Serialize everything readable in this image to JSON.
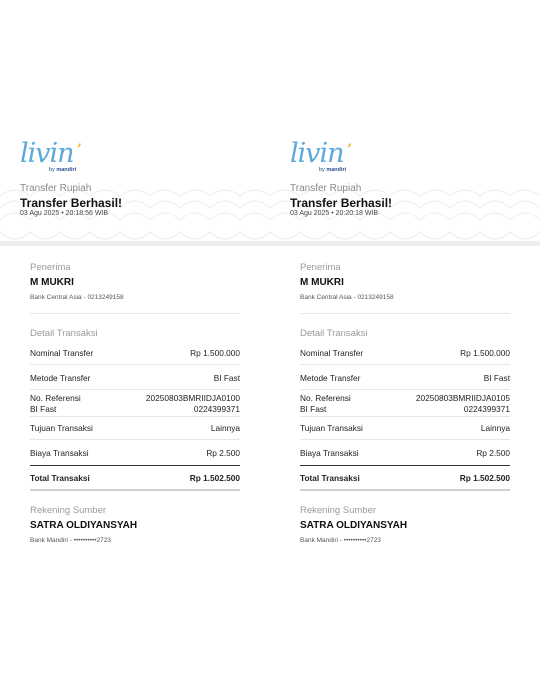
{
  "receipts": [
    {
      "logo": {
        "word": "livin",
        "apostrophe": "’",
        "by": "by",
        "brand": "mandiri"
      },
      "header": {
        "subtitle": "Transfer Rupiah",
        "title": "Transfer Berhasil!",
        "datetime": "03 Agu 2025 • 20:18:56 WIB"
      },
      "recipient": {
        "label": "Penerima",
        "name": "M MUKRI",
        "bank_info": "Bank Central Asia - 0213249158"
      },
      "detail": {
        "label": "Detail Transaksi",
        "nominal_label": "Nominal Transfer",
        "nominal_value": "Rp 1.500.000",
        "method_label": "Metode Transfer",
        "method_value": "BI Fast",
        "ref_label": "No. Referensi",
        "ref_value": "20250803BMRIIDJA0100",
        "bifast_label": "BI Fast",
        "bifast_value": "0224399371",
        "purpose_label": "Tujuan Transaksi",
        "purpose_value": "Lainnya",
        "fee_label": "Biaya Transaksi",
        "fee_value": "Rp 2.500",
        "total_label": "Total Transaksi",
        "total_value": "Rp 1.502.500"
      },
      "source": {
        "label": "Rekening Sumber",
        "name": "SATRA OLDIYANSYAH",
        "account": "Bank Mandiri - ••••••••••2723"
      }
    },
    {
      "logo": {
        "word": "livin",
        "apostrophe": "’",
        "by": "by",
        "brand": "mandiri"
      },
      "header": {
        "subtitle": "Transfer Rupiah",
        "title": "Transfer Berhasil!",
        "datetime": "03 Agu 2025 • 20:20:18 WIB"
      },
      "recipient": {
        "label": "Penerima",
        "name": "M MUKRI",
        "bank_info": "Bank Central Asia - 0213249158"
      },
      "detail": {
        "label": "Detail Transaksi",
        "nominal_label": "Nominal Transfer",
        "nominal_value": "Rp 1.500.000",
        "method_label": "Metode Transfer",
        "method_value": "BI Fast",
        "ref_label": "No. Referensi",
        "ref_value": "20250803BMRIIDJA0105",
        "bifast_label": "BI Fast",
        "bifast_value": "0224399371",
        "purpose_label": "Tujuan Transaksi",
        "purpose_value": "Lainnya",
        "fee_label": "Biaya Transaksi",
        "fee_value": "Rp 2.500",
        "total_label": "Total Transaksi",
        "total_value": "Rp 1.502.500"
      },
      "source": {
        "label": "Rekening Sumber",
        "name": "SATRA OLDIYANSYAH",
        "account": "Bank Mandiri - ••••••••••2723"
      }
    }
  ],
  "colors": {
    "logo_blue": "#5ba8dc",
    "logo_yellow": "#f2b21c",
    "brand_navy": "#2c4f8a"
  }
}
